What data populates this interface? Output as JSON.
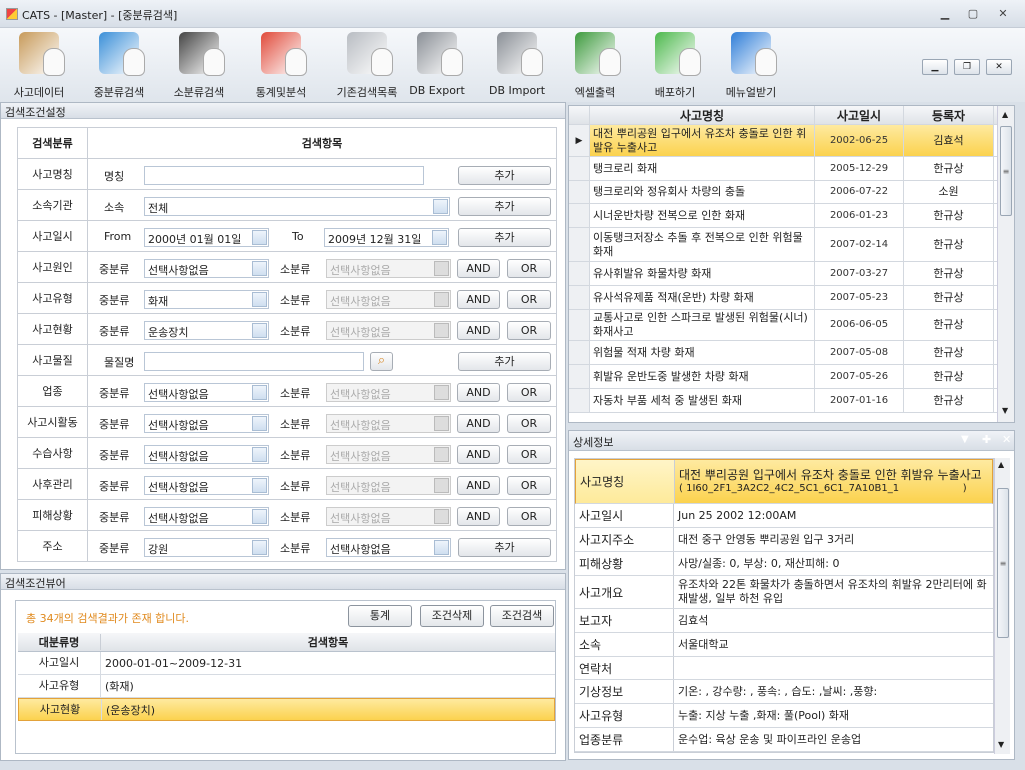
{
  "window": {
    "title": "CATS - [Master] - [중분류검색]"
  },
  "toolbar": [
    {
      "label": "사고데이터",
      "icon": "clipboard-icon",
      "color": "#c79a5a"
    },
    {
      "label": "중분류검색",
      "icon": "monitor-icon",
      "color": "#3a8fd8"
    },
    {
      "label": "소분류검색",
      "icon": "floppy-icon",
      "color": "#444444"
    },
    {
      "label": "통계및분석",
      "icon": "pie-chart-icon",
      "color": "#e04a3a"
    },
    {
      "label": "기존검색목록",
      "icon": "server-tower-icon",
      "color": "#b8bcc2"
    },
    {
      "label": "DB Export",
      "icon": "database-export-icon",
      "color": "#8a8f96"
    },
    {
      "label": "DB Import",
      "icon": "database-import-icon",
      "color": "#8a8f96"
    },
    {
      "label": "엑셀출력",
      "icon": "excel-icon",
      "color": "#3d9a3d"
    },
    {
      "label": "배포하기",
      "icon": "wifi-icon",
      "color": "#4cb84c"
    },
    {
      "label": "메뉴얼받기",
      "icon": "help-icon",
      "color": "#2f7ed8"
    }
  ],
  "left": {
    "title": "검색조건설정",
    "header": {
      "category": "검색분류",
      "items": "검색항목"
    },
    "add": "추가",
    "and": "AND",
    "or": "OR",
    "mid": "중분류",
    "small": "소분류",
    "name_row": {
      "cat": "사고명칭",
      "sub": "명칭",
      "value": ""
    },
    "org_row": {
      "cat": "소속기관",
      "sub": "소속",
      "value": "전체"
    },
    "date_row": {
      "cat": "사고일시",
      "from": "From",
      "from_value": "2000년 01월 01일",
      "to": "To",
      "to_value": "2009년 12월 31일"
    },
    "material_row": {
      "cat": "사고물질",
      "sub": "물질명",
      "value": ""
    },
    "combo_rows": [
      {
        "cat": "사고원인",
        "mid": "선택사항없음",
        "small": "선택사항없음",
        "type": "andor"
      },
      {
        "cat": "사고유형",
        "mid": "화재",
        "small": "선택사항없음",
        "type": "andor"
      },
      {
        "cat": "사고현황",
        "mid": "운송장치",
        "small": "선택사항없음",
        "type": "andor"
      }
    ],
    "combo_rows2": [
      {
        "cat": "업종",
        "mid": "선택사항없음",
        "small": "선택사항없음",
        "type": "andor"
      },
      {
        "cat": "사고시활동",
        "mid": "선택사항없음",
        "small": "선택사항없음",
        "type": "andor"
      },
      {
        "cat": "수습사항",
        "mid": "선택사항없음",
        "small": "선택사항없음",
        "type": "andor"
      },
      {
        "cat": "사후관리",
        "mid": "선택사항없음",
        "small": "선택사항없음",
        "type": "andor"
      },
      {
        "cat": "피해상황",
        "mid": "선택사항없음",
        "small": "선택사항없음",
        "type": "andor"
      },
      {
        "cat": "주소",
        "mid": "강원",
        "small": "선택사항없음",
        "type": "add"
      }
    ]
  },
  "viewer": {
    "title": "검색조건뷰어",
    "message": "총 34개의 검색결과가 존재 합니다.",
    "buttons": [
      "통계",
      "조건삭제",
      "조건검색"
    ],
    "columns": [
      "대분류명",
      "검색항목"
    ],
    "rows": [
      [
        "사고일시",
        "2000-01-01~2009-12-31"
      ],
      [
        "사고유형",
        "(화재)"
      ],
      [
        "사고현황",
        "(운송장치)"
      ]
    ],
    "selected_row": 2
  },
  "results": {
    "columns": [
      "사고명칭",
      "사고일시",
      "등록자"
    ],
    "rows": [
      [
        "대전 뿌리공원 입구에서 유조차 충돌로 인한 휘발유 누출사고",
        "2002-06-25",
        "김효석"
      ],
      [
        "탱크로리 화재",
        "2005-12-29",
        "한규상"
      ],
      [
        "탱크로리와 정유회사 차량의 충돌",
        "2006-07-22",
        "소원"
      ],
      [
        "시너운반차량 전복으로 인한 화재",
        "2006-01-23",
        "한규상"
      ],
      [
        "이동탱크저장소 추돌 후 전복으로 인한 위험물 화재",
        "2007-02-14",
        "한규상"
      ],
      [
        "유사휘발유 화물차량 화재",
        "2007-03-27",
        "한규상"
      ],
      [
        "유사석유제품 적재(운반) 차량 화재",
        "2007-05-23",
        "한규상"
      ],
      [
        "교통사고로 인한 스파크로 발생된 위험물(시너) 화재사고",
        "2006-06-05",
        "한규상"
      ],
      [
        "위험물 적재 차량 화재",
        "2007-05-08",
        "한규상"
      ],
      [
        "휘발유 운반도중 발생한 차량 화재",
        "2007-05-26",
        "한규상"
      ],
      [
        "자동차 부품 세척 중 발생된 화재",
        "2007-01-16",
        "한규상"
      ]
    ],
    "selected_row": 0
  },
  "detail": {
    "title": "상세정보",
    "rows": [
      {
        "k": "사고명칭",
        "v": "대전 뿌리공원 입구에서 유조차 충돌로 인한 휘발유 누출사고",
        "v2": "( 1I60_2F1_3A2C2_4C2_5C1_6C1_7A10B1_1                    )"
      },
      {
        "k": "사고일시",
        "v": "Jun 25 2002 12:00AM"
      },
      {
        "k": "사고지주소",
        "v": "대전 중구 안영동 뿌리공원 입구 3거리"
      },
      {
        "k": "피해상황",
        "v": "사망/실종: 0, 부상: 0, 재산피해: 0"
      },
      {
        "k": "사고개요",
        "v": "유조차와 22톤 화물차가 충돌하면서 유조차의 휘발유 2만리터에 화재발생, 일부 하천 유입"
      },
      {
        "k": "보고자",
        "v": "김효석"
      },
      {
        "k": "소속",
        "v": "서울대학교"
      },
      {
        "k": "연락처",
        "v": ""
      },
      {
        "k": "기상정보",
        "v": "기온: ,  강수량: ,  풍속: ,  습도:   ,날씨:   ,풍향:"
      },
      {
        "k": "사고유형",
        "v": "누출: 지상 누출   ,화재: 풀(Pool) 화재"
      },
      {
        "k": "업종분류",
        "v": "운수업: 육상 운송 및 파이프라인 운송업"
      }
    ]
  },
  "colors": {
    "selected": "#fbd24e",
    "accent": "#e08a1e"
  }
}
